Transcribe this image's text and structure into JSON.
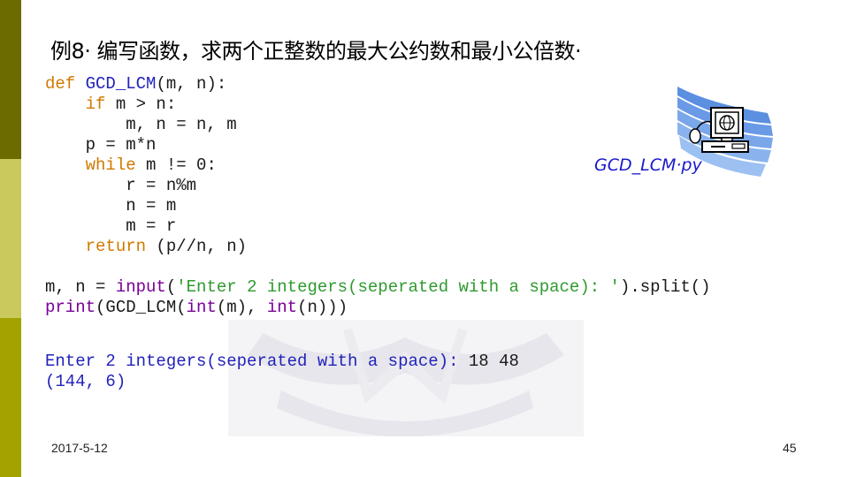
{
  "slide": {
    "title": "例8· 编写函数，求两个正整数的最大公约数和最小公倍数·",
    "date": "2017-5-12",
    "page_number": "45",
    "file_label": "GCD_LCM·py",
    "file_icon": "computer-icon"
  },
  "code": {
    "line1": {
      "kw": "def",
      "name": "GCD_LCM",
      "rest": "(m, n):"
    },
    "line2": {
      "indent": "    ",
      "kw": "if",
      "rest": " m > n:"
    },
    "line3": {
      "indent": "        ",
      "rest": "m, n = n, m"
    },
    "line4": {
      "indent": "    ",
      "rest": "p = m*n"
    },
    "line5": {
      "indent": "    ",
      "kw": "while",
      "rest": " m != 0:"
    },
    "line6": {
      "indent": "        ",
      "rest": "r = n%m"
    },
    "line7": {
      "indent": "        ",
      "rest": "n = m"
    },
    "line8": {
      "indent": "        ",
      "rest": "m = r"
    },
    "line9": {
      "indent": "    ",
      "kw": "return",
      "rest": " (p//n, n)"
    },
    "line10": {
      "a": "m, n = ",
      "b": "input",
      "c": "(",
      "d": "'Enter 2 integers(seperated with a space): '",
      "e": ").split()"
    },
    "line11": {
      "a": "print",
      "b": "(GCD_LCM(",
      "c": "int",
      "d": "(m), ",
      "e": "int",
      "f": "(n)))"
    }
  },
  "output": {
    "prompt": "Enter 2 integers(seperated with a space): ",
    "input": "18 48",
    "result": "(144, 6)"
  },
  "colors": {
    "sidebar_top": "#6b6b00",
    "sidebar_middle": "#c9c95e",
    "sidebar_bottom": "#a3a300",
    "keyword": "#d07a00",
    "function_name": "#2222bb",
    "builtin": "#7a0099",
    "string": "#2e9a2e",
    "output": "#2222bb"
  }
}
